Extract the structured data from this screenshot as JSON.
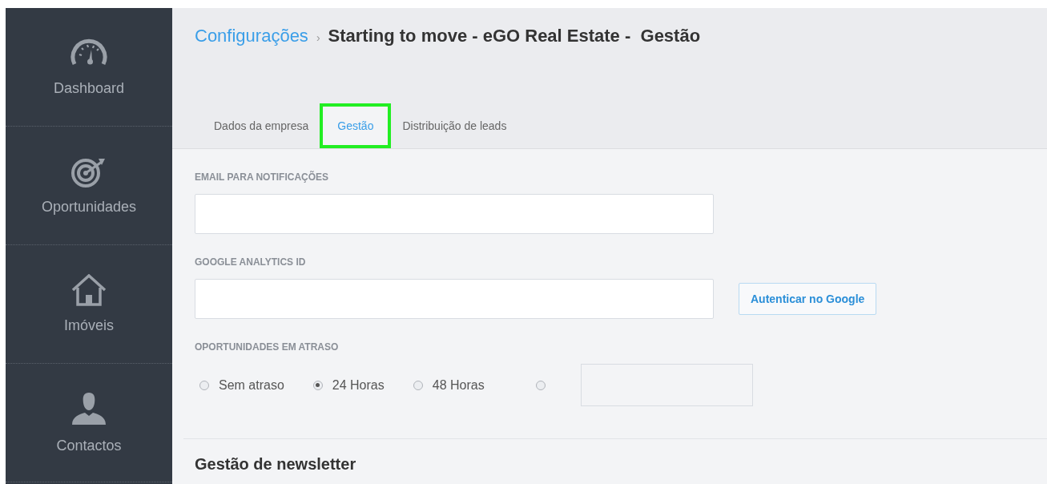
{
  "sidebar": {
    "items": [
      {
        "label": "Dashboard",
        "kind": "gauge"
      },
      {
        "label": "Oportunidades",
        "kind": "target"
      },
      {
        "label": "Imóveis",
        "kind": "house"
      },
      {
        "label": "Contactos",
        "kind": "person"
      }
    ]
  },
  "breadcrumb": {
    "parent": "Configurações",
    "separator": "›",
    "current": "Starting to move - eGO Real Estate -  Gestão"
  },
  "tabs": [
    {
      "label": "Dados da empresa",
      "selected": false
    },
    {
      "label": "Gestão",
      "selected": true
    },
    {
      "label": "Distribuição de leads",
      "selected": false
    }
  ],
  "form": {
    "email_label": "EMAIL PARA NOTIFICAÇÕES",
    "analytics_label": "GOOGLE ANALYTICS ID",
    "auth_button": "Autenticar no Google",
    "delay_label": "OPORTUNIDADES EM ATRASO",
    "delay_options": [
      {
        "kind": "label",
        "label": "Sem atraso",
        "selected": false
      },
      {
        "kind": "label",
        "label": "24 Horas",
        "selected": true
      },
      {
        "kind": "label",
        "label": "48 Horas",
        "selected": false
      },
      {
        "kind": "custom",
        "selected": false
      }
    ]
  },
  "section_title": "Gestão de newsletter"
}
